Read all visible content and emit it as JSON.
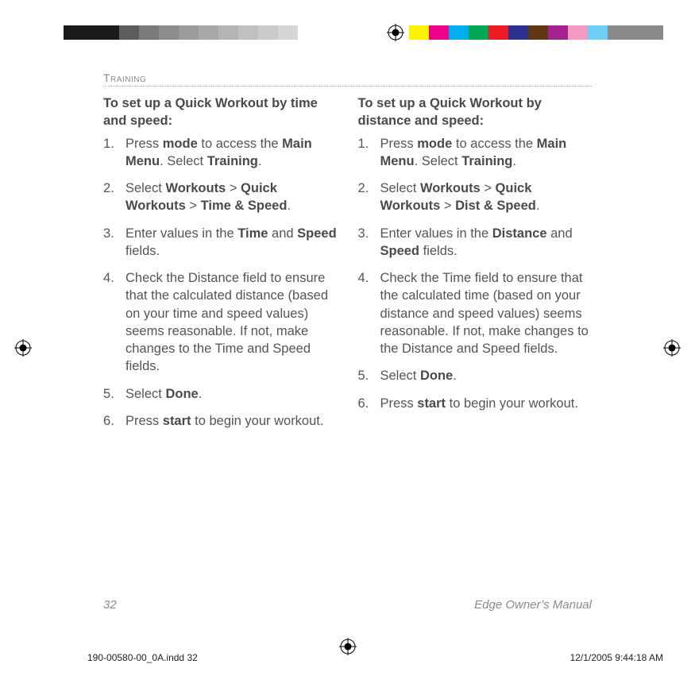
{
  "section": "Training",
  "left": {
    "lead": "To set up a Quick Workout by time and speed:",
    "steps": [
      [
        {
          "t": "Press "
        },
        {
          "t": "mode",
          "b": true
        },
        {
          "t": " to access the "
        },
        {
          "t": "Main Menu",
          "b": true
        },
        {
          "t": ". Select "
        },
        {
          "t": "Training",
          "b": true
        },
        {
          "t": "."
        }
      ],
      [
        {
          "t": "Select "
        },
        {
          "t": "Workouts",
          "b": true
        },
        {
          "t": " > "
        },
        {
          "t": "Quick Workouts",
          "b": true
        },
        {
          "t": " > "
        },
        {
          "t": "Time & Speed",
          "b": true
        },
        {
          "t": "."
        }
      ],
      [
        {
          "t": "Enter values in the "
        },
        {
          "t": "Time",
          "b": true
        },
        {
          "t": " and "
        },
        {
          "t": "Speed",
          "b": true
        },
        {
          "t": " fields."
        }
      ],
      [
        {
          "t": "Check the Distance field to ensure that the calculated distance (based on your time and speed values) seems reasonable. If not, make changes to the Time and Speed fields."
        }
      ],
      [
        {
          "t": "Select "
        },
        {
          "t": "Done",
          "b": true
        },
        {
          "t": "."
        }
      ],
      [
        {
          "t": "Press "
        },
        {
          "t": "start",
          "b": true
        },
        {
          "t": " to begin your workout."
        }
      ]
    ]
  },
  "right": {
    "lead": "To set up a Quick Workout by distance and speed:",
    "steps": [
      [
        {
          "t": "Press "
        },
        {
          "t": "mode",
          "b": true
        },
        {
          "t": " to access the "
        },
        {
          "t": "Main Menu",
          "b": true
        },
        {
          "t": ". Select "
        },
        {
          "t": "Training",
          "b": true
        },
        {
          "t": "."
        }
      ],
      [
        {
          "t": "Select "
        },
        {
          "t": "Workouts",
          "b": true
        },
        {
          "t": " > "
        },
        {
          "t": "Quick Workouts",
          "b": true
        },
        {
          "t": " > "
        },
        {
          "t": "Dist & Speed",
          "b": true
        },
        {
          "t": "."
        }
      ],
      [
        {
          "t": "Enter values in the "
        },
        {
          "t": "Distance",
          "b": true
        },
        {
          "t": " and "
        },
        {
          "t": "Speed",
          "b": true
        },
        {
          "t": " fields."
        }
      ],
      [
        {
          "t": "Check the Time field to ensure that the calculated time (based on your distance and speed values) seems reasonable. If not, make changes to the Distance and Speed fields."
        }
      ],
      [
        {
          "t": "Select "
        },
        {
          "t": "Done",
          "b": true
        },
        {
          "t": "."
        }
      ],
      [
        {
          "t": "Press "
        },
        {
          "t": "start",
          "b": true
        },
        {
          "t": " to begin your workout."
        }
      ]
    ]
  },
  "footer": {
    "page": "32",
    "title": "Edge Owner’s Manual"
  },
  "slug": {
    "file": "190-00580-00_0A.indd   32",
    "stamp": "12/1/2005   9:44:18 AM"
  },
  "swatches_left": [
    "#1a1a1a",
    "#5d5d5d",
    "#7a7a7a",
    "#8c8c8c",
    "#9b9b9b",
    "#a8a8a8",
    "#b4b4b4",
    "#c0c0c0",
    "#cbcbcb",
    "#d6d6d6"
  ],
  "swatches_right": [
    "#fff200",
    "#ec008c",
    "#00aeef",
    "#00a651",
    "#ed1c24",
    "#2e3192",
    "#603913",
    "#a3238e",
    "#f49ac1",
    "#6dcff6",
    "#8a8a8a"
  ]
}
